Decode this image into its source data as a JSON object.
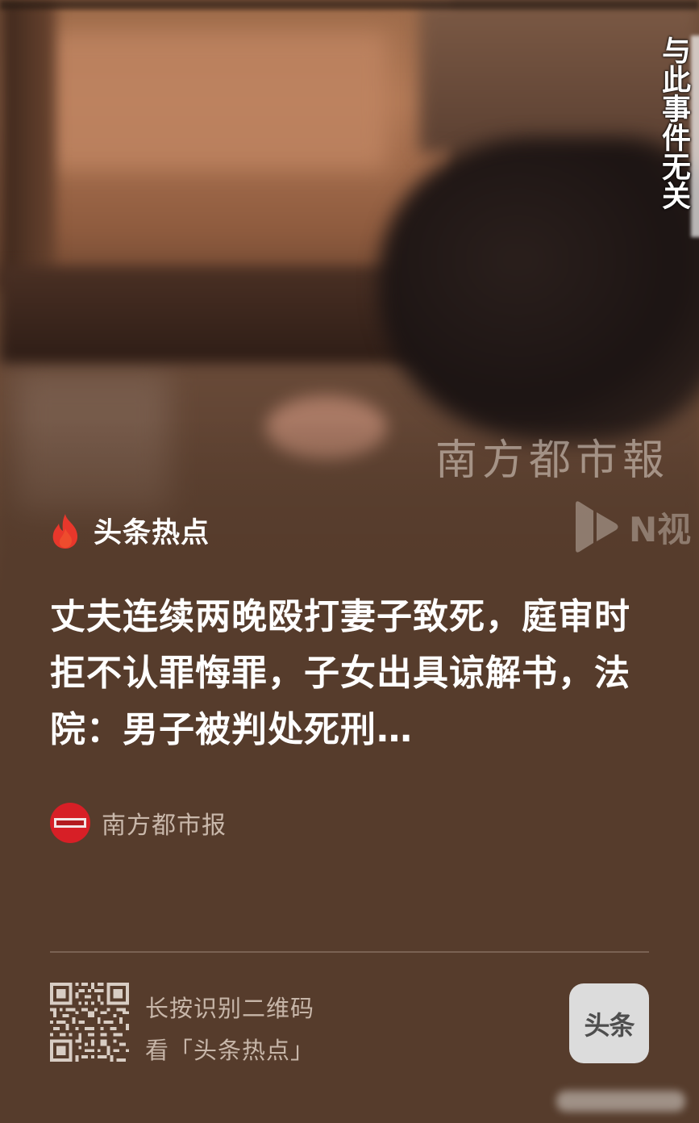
{
  "video": {
    "caption": "与此事件无关",
    "watermark_text": "南方都市報",
    "watermark_logo": "N视"
  },
  "tag": {
    "label": "头条热点",
    "icon": "flame-icon",
    "color": "#e8372b"
  },
  "headline": "丈夫连续两晚殴打妻子致死，庭审时拒不认罪悔罪，子女出具谅解书，法院：男子被判处死刑…",
  "source": {
    "name": "南方都市报",
    "avatar_color": "#d71f26"
  },
  "footer": {
    "qr_line1": "长按识别二维码",
    "qr_line2": "看「头条热点」",
    "app_label": "头条"
  }
}
